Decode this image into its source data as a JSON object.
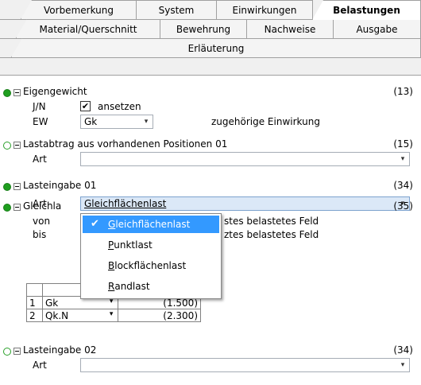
{
  "tabs": {
    "row1": [
      "Vorbemerkung",
      "System",
      "Einwirkungen",
      "Belastungen"
    ],
    "row2": [
      "Material/Querschnitt",
      "Bewehrung",
      "Nachweise",
      "Ausgabe"
    ],
    "row3": [
      "Erläuterung"
    ]
  },
  "sections": {
    "eigengewicht": {
      "title": "Eigengewicht",
      "count": "(13)",
      "jn_label": "J/N",
      "ansetzen": "ansetzen",
      "ew_label": "EW",
      "ew_value": "Gk",
      "ew_note": "zugehörige Einwirkung"
    },
    "lastabtrag": {
      "title": "Lastabtrag aus vorhandenen Positionen 01",
      "count": "(15)",
      "art_label": "Art",
      "art_value": ""
    },
    "lasteingabe01": {
      "title": "Lasteingabe 01",
      "count": "(34)",
      "art_label": "Art",
      "art_value": "Gleichflächenlast"
    },
    "gleichla": {
      "title": "Gleichla",
      "count": "(35)",
      "von_label": "von",
      "von_text": "stes belastetes Feld",
      "bis_label": "bis",
      "bis_text": "ztes belastetes Feld",
      "rows": [
        {
          "num": "1",
          "name": "Gk",
          "value": "(1.500)"
        },
        {
          "num": "2",
          "name": "Qk.N",
          "value": "(2.300)"
        }
      ]
    },
    "lasteingabe02": {
      "title": "Lasteingabe 02",
      "count": "(34)",
      "art_label": "Art",
      "art_value": ""
    }
  },
  "dropdown": {
    "items": [
      {
        "first": "G",
        "rest": "leichflächenlast",
        "selected": true
      },
      {
        "first": "P",
        "rest": "unktlast",
        "selected": false
      },
      {
        "first": "B",
        "rest": "lockflächenlast",
        "selected": false
      },
      {
        "first": "R",
        "rest": "andlast",
        "selected": false
      }
    ]
  },
  "icons": {
    "check": "✔",
    "combo_arrow": "▾"
  }
}
